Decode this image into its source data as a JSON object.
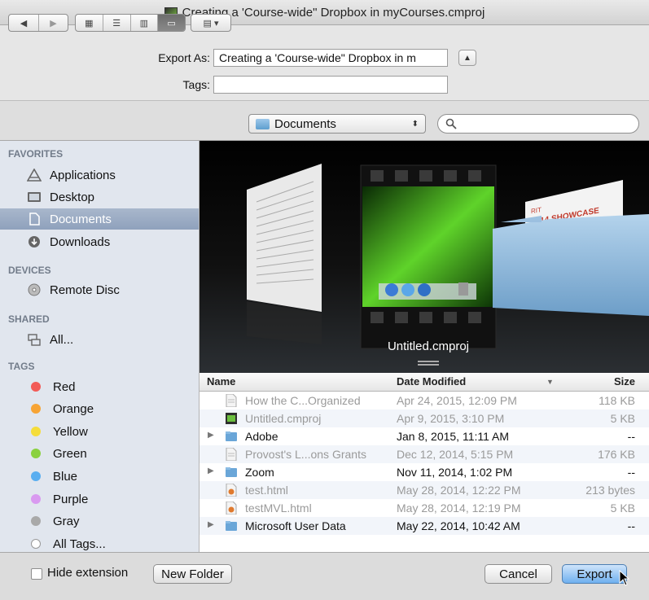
{
  "window": {
    "title": "Creating a 'Course-wide\" Dropbox in myCourses.cmproj"
  },
  "form": {
    "export_as_label": "Export As:",
    "export_as_value": "Creating a 'Course-wide\" Dropbox in m",
    "tags_label": "Tags:",
    "tags_value": ""
  },
  "toolbar": {
    "location": "Documents",
    "search_placeholder": ""
  },
  "sidebar": {
    "favorites_header": "FAVORITES",
    "favorites": [
      {
        "label": "Applications",
        "icon": "applications-icon"
      },
      {
        "label": "Desktop",
        "icon": "desktop-icon"
      },
      {
        "label": "Documents",
        "icon": "documents-icon",
        "selected": true
      },
      {
        "label": "Downloads",
        "icon": "downloads-icon"
      }
    ],
    "devices_header": "DEVICES",
    "devices": [
      {
        "label": "Remote Disc",
        "icon": "remote-disc-icon"
      }
    ],
    "shared_header": "SHARED",
    "shared": [
      {
        "label": "All...",
        "icon": "network-icon"
      }
    ],
    "tags_header": "TAGS",
    "tags": [
      {
        "label": "Red",
        "color": "#f25b57"
      },
      {
        "label": "Orange",
        "color": "#f7a435"
      },
      {
        "label": "Yellow",
        "color": "#f5dd3b"
      },
      {
        "label": "Green",
        "color": "#8ad13f"
      },
      {
        "label": "Blue",
        "color": "#59aef0"
      },
      {
        "label": "Purple",
        "color": "#d99af0"
      },
      {
        "label": "Gray",
        "color": "#a9a9a9"
      },
      {
        "label": "All Tags...",
        "color": ""
      }
    ]
  },
  "coverflow": {
    "caption": "Untitled.cmproj",
    "doc_title_1": "RIT",
    "doc_title_2": "2014 SHOWCASE"
  },
  "columns": {
    "name": "Name",
    "date": "Date Modified",
    "size": "Size"
  },
  "files": [
    {
      "name": "How the C...Organized",
      "date": "Apr 24, 2015, 12:09 PM",
      "size": "118 KB",
      "kind": "doc",
      "dim": true
    },
    {
      "name": "Untitled.cmproj",
      "date": "Apr 9, 2015, 3:10 PM",
      "size": "5 KB",
      "kind": "project",
      "dim": true
    },
    {
      "name": "Adobe",
      "date": "Jan 8, 2015, 11:11 AM",
      "size": "--",
      "kind": "folder",
      "dim": false
    },
    {
      "name": "Provost's L...ons Grants",
      "date": "Dec 12, 2014, 5:15 PM",
      "size": "176 KB",
      "kind": "doc",
      "dim": true
    },
    {
      "name": "Zoom",
      "date": "Nov 11, 2014, 1:02 PM",
      "size": "--",
      "kind": "folder",
      "dim": false
    },
    {
      "name": "test.html",
      "date": "May 28, 2014, 12:22 PM",
      "size": "213 bytes",
      "kind": "html",
      "dim": true
    },
    {
      "name": "testMVL.html",
      "date": "May 28, 2014, 12:19 PM",
      "size": "5 KB",
      "kind": "html",
      "dim": true
    },
    {
      "name": "Microsoft User Data",
      "date": "May 22, 2014, 10:42 AM",
      "size": "--",
      "kind": "folder",
      "dim": false
    }
  ],
  "bottom": {
    "hide_extension_label": "Hide extension",
    "new_folder_label": "New Folder",
    "cancel_label": "Cancel",
    "export_label": "Export"
  }
}
